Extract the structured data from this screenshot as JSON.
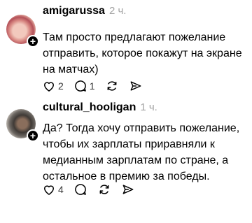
{
  "comments": [
    {
      "username": "amigarussa",
      "time": "2 ч.",
      "text": "Там просто предлагают пожелание\nотправить, которое покажут на экране\nна матчах)",
      "likes": "2",
      "replies": "1",
      "avatar_icon": "profile-photo",
      "badge_icon": "plus-icon"
    },
    {
      "username": "cultural_hooligan",
      "time": "1 ч.",
      "text": "Да? Тогда хочу отправить пожелание,\nчтобы их зарплаты приравняли к\nмедианным зарплатам по стране, а\nостальное в премию за победы.",
      "likes": "4",
      "replies": "",
      "avatar_icon": "profile-photo",
      "badge_icon": "plus-icon"
    }
  ],
  "badge_symbol": "+"
}
